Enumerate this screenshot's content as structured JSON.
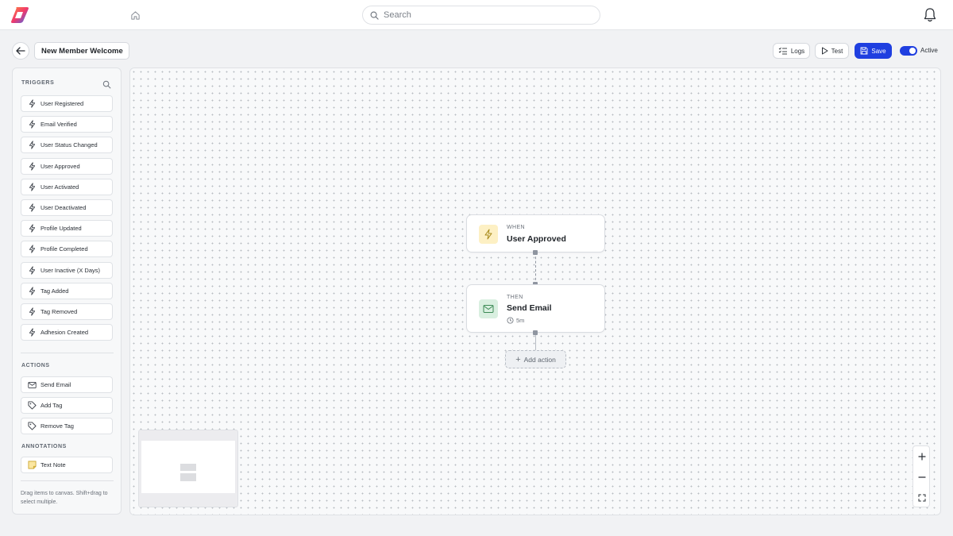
{
  "app": {
    "search": {
      "placeholder": "Search"
    }
  },
  "editor": {
    "workflow_name": "New Member Welcome",
    "logs_label": "Logs",
    "test_label": "Test",
    "save_label": "Save",
    "active_label": "Active",
    "active": true,
    "accent_color": "#1f3fe0"
  },
  "sidebar": {
    "triggers_title": "TRIGGERS",
    "triggers": [
      {
        "label": "User Registered",
        "icon": "lightning-icon"
      },
      {
        "label": "Email Verified",
        "icon": "lightning-icon"
      },
      {
        "label": "User Status Changed",
        "icon": "lightning-icon"
      },
      {
        "label": "User Approved",
        "icon": "lightning-icon"
      },
      {
        "label": "User Activated",
        "icon": "lightning-icon"
      },
      {
        "label": "User Deactivated",
        "icon": "lightning-icon"
      },
      {
        "label": "Profile Updated",
        "icon": "lightning-icon"
      },
      {
        "label": "Profile Completed",
        "icon": "lightning-icon"
      },
      {
        "label": "User Inactive (X Days)",
        "icon": "lightning-icon"
      },
      {
        "label": "Tag Added",
        "icon": "lightning-icon"
      },
      {
        "label": "Tag Removed",
        "icon": "lightning-icon"
      },
      {
        "label": "Adhesion Created",
        "icon": "lightning-icon"
      }
    ],
    "actions_title": "ACTIONS",
    "actions": [
      {
        "label": "Send Email",
        "icon": "mail-icon"
      },
      {
        "label": "Add Tag",
        "icon": "tag-icon"
      },
      {
        "label": "Remove Tag",
        "icon": "tag-icon"
      }
    ],
    "annotations_title": "ANNOTATIONS",
    "annotations": [
      {
        "label": "Text Note",
        "icon": "note-icon"
      }
    ],
    "hint": "Drag items to canvas. Shift+drag to select multiple."
  },
  "canvas": {
    "trigger_node": {
      "label": "WHEN",
      "title": "User Approved",
      "icon": "lightning-icon",
      "icon_bg": "#fdf0c4"
    },
    "action_node": {
      "label": "THEN",
      "title": "Send Email",
      "delay": "5m",
      "icon": "mail-icon",
      "icon_bg": "#d9efe0"
    },
    "add_action_label": "Add action"
  }
}
